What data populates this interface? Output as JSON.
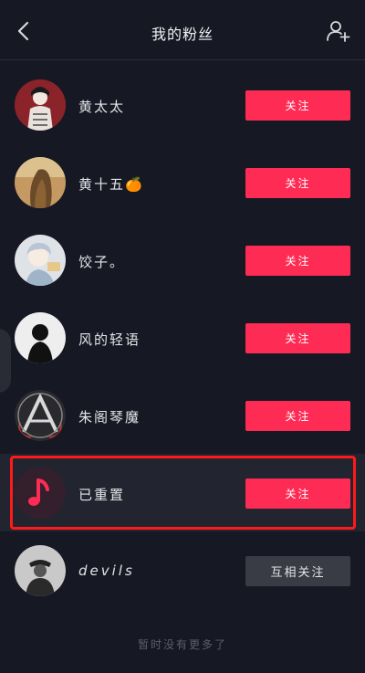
{
  "header": {
    "title": "我的粉丝",
    "back_icon": "chevron-left-icon",
    "add_icon": "add-user-icon"
  },
  "followers": [
    {
      "name": "黄太太",
      "button": "关注",
      "button_style": "red",
      "avatar": "avatar-dark-red"
    },
    {
      "name": "黄十五🍊",
      "button": "关注",
      "button_style": "red",
      "avatar": "avatar-tan-hair"
    },
    {
      "name": "饺子。",
      "button": "关注",
      "button_style": "red",
      "avatar": "avatar-anime-pale"
    },
    {
      "name": "风的轻语",
      "button": "关注",
      "button_style": "red",
      "avatar": "avatar-silhouette"
    },
    {
      "name": "朱阁琴魔",
      "button": "关注",
      "button_style": "red",
      "avatar": "avatar-avengers"
    },
    {
      "name": "已重置",
      "button": "关注",
      "button_style": "red",
      "avatar": "music-note-icon",
      "highlighted": true
    },
    {
      "name": "devils",
      "button": "互相关注",
      "button_style": "grey",
      "avatar": "avatar-grey-figure"
    }
  ],
  "footer": {
    "text": "暂时没有更多了"
  },
  "colors": {
    "background": "#161823",
    "follow_red": "#fe2c55",
    "mutual_grey": "#393b45",
    "highlight_border": "#ff1a1a"
  }
}
